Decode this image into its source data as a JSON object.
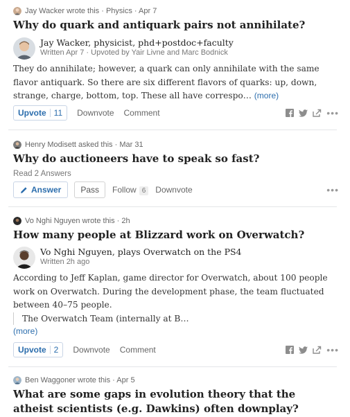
{
  "feed": [
    {
      "meta": "Jay Wacker wrote this · Physics · Apr 7",
      "title": "Why do quark and antiquark pairs not annihilate?",
      "author_name": "Jay Wacker, physicist, phd+postdoc+faculty",
      "author_sub": "Written Apr 7 · Upvoted by Yair Livne and Marc Bodnick",
      "answer": "They do annihilate; however, a quark can only annihilate with the same flavor antiquark. So there are six different flavors of quarks: up, down, strange, charge, bottom, top. These all have correspo…",
      "more": "(more)",
      "upvote_label": "Upvote",
      "upvote_count": "11",
      "downvote": "Downvote",
      "comment": "Comment"
    },
    {
      "meta": "Henry Modisett asked this · Mar 31",
      "title": "Why do auctioneers have to speak so fast?",
      "read_answers": "Read 2 Answers",
      "answer_label": "Answer",
      "pass_label": "Pass",
      "follow_label": "Follow",
      "follow_count": "6",
      "downvote": "Downvote"
    },
    {
      "meta": "Vo Nghi Nguyen wrote this · 2h",
      "title": "How many people at Blizzard work on Overwatch?",
      "author_name": "Vo Nghi Nguyen, plays Overwatch on the PS4",
      "author_sub": "Written 2h ago",
      "answer": "According to Jeff Kaplan, game director for Overwatch, about 100 people work on Overwatch. During the development phase, the team fluctuated between 40–75 people.",
      "quote": "The Overwatch Team (internally at B…",
      "more": "(more)",
      "upvote_label": "Upvote",
      "upvote_count": "2",
      "downvote": "Downvote",
      "comment": "Comment"
    },
    {
      "meta": "Ben Waggoner wrote this · Apr 5",
      "title": "What are some gaps in evolution theory that the atheist scientists (e.g. Dawkins) often downplay?"
    }
  ],
  "icons": {
    "facebook": "facebook-icon",
    "twitter": "twitter-icon",
    "share": "share-icon",
    "more": "more-options-icon",
    "pencil": "pencil-icon"
  },
  "colors": {
    "link_blue": "#2b6dad",
    "meta_gray": "#666666",
    "title_black": "#222222"
  },
  "symbols": {
    "dots": "•••"
  }
}
